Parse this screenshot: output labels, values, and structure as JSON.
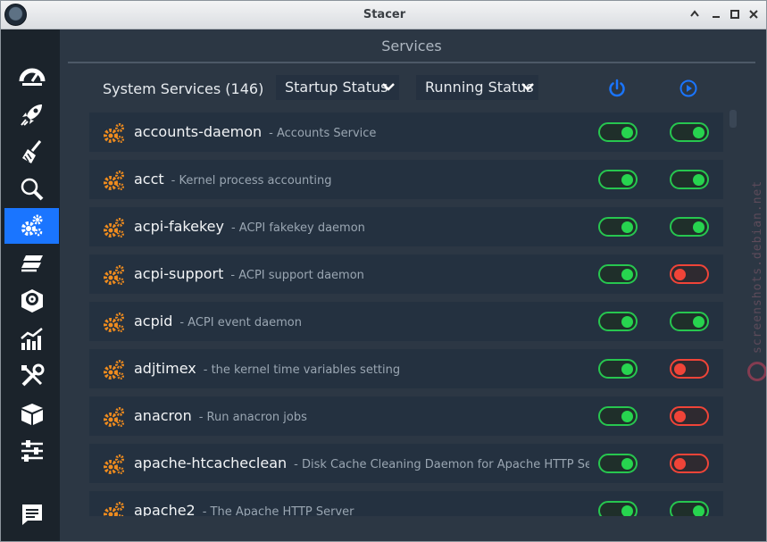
{
  "window": {
    "title": "Stacer"
  },
  "header": {
    "page_title": "Services",
    "services_label": "System Services (146)",
    "startup_dropdown": "Startup Status",
    "running_dropdown": "Running Status",
    "startup_icon": "power-icon",
    "running_icon": "play-circle-icon"
  },
  "sidebar": {
    "items": [
      {
        "icon": "speedometer-icon"
      },
      {
        "icon": "rocket-icon"
      },
      {
        "icon": "broom-icon"
      },
      {
        "icon": "search-icon"
      },
      {
        "icon": "gears-icon",
        "active": true
      },
      {
        "icon": "processes-icon"
      },
      {
        "icon": "uninstaller-icon"
      },
      {
        "icon": "resources-chart-icon"
      },
      {
        "icon": "tools-icon"
      },
      {
        "icon": "package-icon"
      },
      {
        "icon": "settings-sliders-icon"
      },
      {
        "icon": "feedback-icon"
      }
    ]
  },
  "services": [
    {
      "name": "accounts-daemon",
      "desc": "- Accounts Service",
      "startup": true,
      "running": true
    },
    {
      "name": "acct",
      "desc": "- Kernel process accounting",
      "startup": true,
      "running": true
    },
    {
      "name": "acpi-fakekey",
      "desc": "- ACPI fakekey daemon",
      "startup": true,
      "running": true
    },
    {
      "name": "acpi-support",
      "desc": "- ACPI support daemon",
      "startup": true,
      "running": false
    },
    {
      "name": "acpid",
      "desc": "- ACPI event daemon",
      "startup": true,
      "running": true
    },
    {
      "name": "adjtimex",
      "desc": "- the kernel time variables setting",
      "startup": true,
      "running": false
    },
    {
      "name": "anacron",
      "desc": "- Run anacron jobs",
      "startup": true,
      "running": false
    },
    {
      "name": "apache-htcacheclean",
      "desc": "- Disk Cache Cleaning Daemon for Apache HTTP Ser",
      "startup": true,
      "running": false
    },
    {
      "name": "apache2",
      "desc": "- The Apache HTTP Server",
      "startup": true,
      "running": true
    }
  ],
  "watermark": "screenshots.debian.net",
  "colors": {
    "accent": "#1a75ff",
    "on": "#27d44f",
    "off": "#f04438",
    "gear": "#f08c1e"
  }
}
